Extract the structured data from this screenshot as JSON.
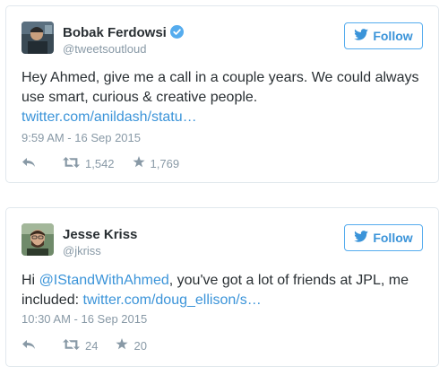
{
  "tweets": [
    {
      "name": "Bobak Ferdowsi",
      "handle": "@tweetsoutloud",
      "verified": true,
      "follow_label": "Follow",
      "text_line1": "Hey Ahmed, give me a call in a couple years. We could always",
      "text_line2": "use smart, curious & creative people.",
      "link": "twitter.com/anildash/statu…",
      "timestamp": "9:59 AM - 16 Sep 2015",
      "retweets": "1,542",
      "favorites": "1,769"
    },
    {
      "name": "Jesse Kriss",
      "handle": "@jkriss",
      "verified": false,
      "follow_label": "Follow",
      "text_prefix": "Hi ",
      "mention": "@IStandWithAhmed",
      "text_mid": ", you've got a lot of friends at JPL, me",
      "text_line2_prefix": "included: ",
      "link": "twitter.com/doug_ellison/s…",
      "timestamp": "10:30 AM - 16 Sep 2015",
      "retweets": "24",
      "favorites": "20"
    }
  ],
  "colors": {
    "accent": "#3b94d9",
    "muted": "#8899a6",
    "border": "#e1e8ed",
    "text": "#292f33"
  },
  "icons": [
    "avatar",
    "verified-icon",
    "twitter-bird-icon",
    "reply-icon",
    "retweet-icon",
    "favorite-star-icon"
  ]
}
